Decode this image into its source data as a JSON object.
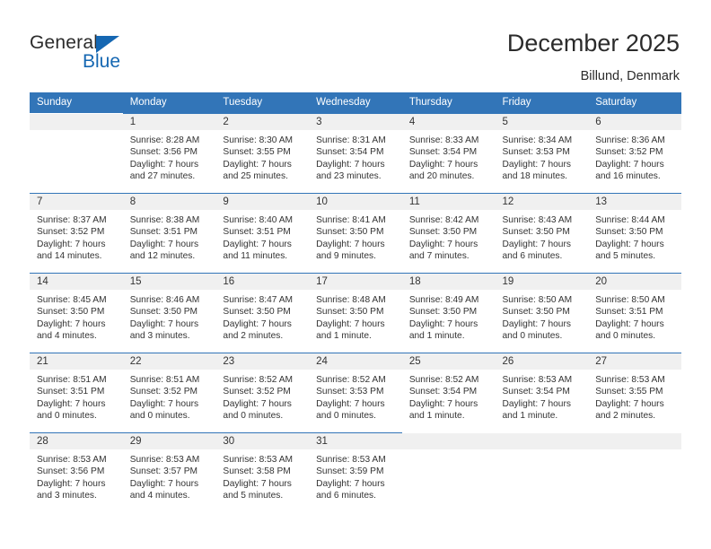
{
  "logo": {
    "word1": "General",
    "word2": "Blue",
    "triangle_color": "#1567b2",
    "text_color": "#2b2b2b"
  },
  "header": {
    "title": "December 2025",
    "subtitle": "Billund, Denmark"
  },
  "theme": {
    "header_blue": "#3275b8",
    "daynum_band": "#f0f0f0",
    "text": "#333333"
  },
  "weekday_headers": [
    "Sunday",
    "Monday",
    "Tuesday",
    "Wednesday",
    "Thursday",
    "Friday",
    "Saturday"
  ],
  "weeks": [
    [
      {
        "empty": true
      },
      {
        "day": "1",
        "sunrise": "Sunrise: 8:28 AM",
        "sunset": "Sunset: 3:56 PM",
        "daylight1": "Daylight: 7 hours",
        "daylight2": "and 27 minutes."
      },
      {
        "day": "2",
        "sunrise": "Sunrise: 8:30 AM",
        "sunset": "Sunset: 3:55 PM",
        "daylight1": "Daylight: 7 hours",
        "daylight2": "and 25 minutes."
      },
      {
        "day": "3",
        "sunrise": "Sunrise: 8:31 AM",
        "sunset": "Sunset: 3:54 PM",
        "daylight1": "Daylight: 7 hours",
        "daylight2": "and 23 minutes."
      },
      {
        "day": "4",
        "sunrise": "Sunrise: 8:33 AM",
        "sunset": "Sunset: 3:54 PM",
        "daylight1": "Daylight: 7 hours",
        "daylight2": "and 20 minutes."
      },
      {
        "day": "5",
        "sunrise": "Sunrise: 8:34 AM",
        "sunset": "Sunset: 3:53 PM",
        "daylight1": "Daylight: 7 hours",
        "daylight2": "and 18 minutes."
      },
      {
        "day": "6",
        "sunrise": "Sunrise: 8:36 AM",
        "sunset": "Sunset: 3:52 PM",
        "daylight1": "Daylight: 7 hours",
        "daylight2": "and 16 minutes."
      }
    ],
    [
      {
        "day": "7",
        "sunrise": "Sunrise: 8:37 AM",
        "sunset": "Sunset: 3:52 PM",
        "daylight1": "Daylight: 7 hours",
        "daylight2": "and 14 minutes."
      },
      {
        "day": "8",
        "sunrise": "Sunrise: 8:38 AM",
        "sunset": "Sunset: 3:51 PM",
        "daylight1": "Daylight: 7 hours",
        "daylight2": "and 12 minutes."
      },
      {
        "day": "9",
        "sunrise": "Sunrise: 8:40 AM",
        "sunset": "Sunset: 3:51 PM",
        "daylight1": "Daylight: 7 hours",
        "daylight2": "and 11 minutes."
      },
      {
        "day": "10",
        "sunrise": "Sunrise: 8:41 AM",
        "sunset": "Sunset: 3:50 PM",
        "daylight1": "Daylight: 7 hours",
        "daylight2": "and 9 minutes."
      },
      {
        "day": "11",
        "sunrise": "Sunrise: 8:42 AM",
        "sunset": "Sunset: 3:50 PM",
        "daylight1": "Daylight: 7 hours",
        "daylight2": "and 7 minutes."
      },
      {
        "day": "12",
        "sunrise": "Sunrise: 8:43 AM",
        "sunset": "Sunset: 3:50 PM",
        "daylight1": "Daylight: 7 hours",
        "daylight2": "and 6 minutes."
      },
      {
        "day": "13",
        "sunrise": "Sunrise: 8:44 AM",
        "sunset": "Sunset: 3:50 PM",
        "daylight1": "Daylight: 7 hours",
        "daylight2": "and 5 minutes."
      }
    ],
    [
      {
        "day": "14",
        "sunrise": "Sunrise: 8:45 AM",
        "sunset": "Sunset: 3:50 PM",
        "daylight1": "Daylight: 7 hours",
        "daylight2": "and 4 minutes."
      },
      {
        "day": "15",
        "sunrise": "Sunrise: 8:46 AM",
        "sunset": "Sunset: 3:50 PM",
        "daylight1": "Daylight: 7 hours",
        "daylight2": "and 3 minutes."
      },
      {
        "day": "16",
        "sunrise": "Sunrise: 8:47 AM",
        "sunset": "Sunset: 3:50 PM",
        "daylight1": "Daylight: 7 hours",
        "daylight2": "and 2 minutes."
      },
      {
        "day": "17",
        "sunrise": "Sunrise: 8:48 AM",
        "sunset": "Sunset: 3:50 PM",
        "daylight1": "Daylight: 7 hours",
        "daylight2": "and 1 minute."
      },
      {
        "day": "18",
        "sunrise": "Sunrise: 8:49 AM",
        "sunset": "Sunset: 3:50 PM",
        "daylight1": "Daylight: 7 hours",
        "daylight2": "and 1 minute."
      },
      {
        "day": "19",
        "sunrise": "Sunrise: 8:50 AM",
        "sunset": "Sunset: 3:50 PM",
        "daylight1": "Daylight: 7 hours",
        "daylight2": "and 0 minutes."
      },
      {
        "day": "20",
        "sunrise": "Sunrise: 8:50 AM",
        "sunset": "Sunset: 3:51 PM",
        "daylight1": "Daylight: 7 hours",
        "daylight2": "and 0 minutes."
      }
    ],
    [
      {
        "day": "21",
        "sunrise": "Sunrise: 8:51 AM",
        "sunset": "Sunset: 3:51 PM",
        "daylight1": "Daylight: 7 hours",
        "daylight2": "and 0 minutes."
      },
      {
        "day": "22",
        "sunrise": "Sunrise: 8:51 AM",
        "sunset": "Sunset: 3:52 PM",
        "daylight1": "Daylight: 7 hours",
        "daylight2": "and 0 minutes."
      },
      {
        "day": "23",
        "sunrise": "Sunrise: 8:52 AM",
        "sunset": "Sunset: 3:52 PM",
        "daylight1": "Daylight: 7 hours",
        "daylight2": "and 0 minutes."
      },
      {
        "day": "24",
        "sunrise": "Sunrise: 8:52 AM",
        "sunset": "Sunset: 3:53 PM",
        "daylight1": "Daylight: 7 hours",
        "daylight2": "and 0 minutes."
      },
      {
        "day": "25",
        "sunrise": "Sunrise: 8:52 AM",
        "sunset": "Sunset: 3:54 PM",
        "daylight1": "Daylight: 7 hours",
        "daylight2": "and 1 minute."
      },
      {
        "day": "26",
        "sunrise": "Sunrise: 8:53 AM",
        "sunset": "Sunset: 3:54 PM",
        "daylight1": "Daylight: 7 hours",
        "daylight2": "and 1 minute."
      },
      {
        "day": "27",
        "sunrise": "Sunrise: 8:53 AM",
        "sunset": "Sunset: 3:55 PM",
        "daylight1": "Daylight: 7 hours",
        "daylight2": "and 2 minutes."
      }
    ],
    [
      {
        "day": "28",
        "sunrise": "Sunrise: 8:53 AM",
        "sunset": "Sunset: 3:56 PM",
        "daylight1": "Daylight: 7 hours",
        "daylight2": "and 3 minutes."
      },
      {
        "day": "29",
        "sunrise": "Sunrise: 8:53 AM",
        "sunset": "Sunset: 3:57 PM",
        "daylight1": "Daylight: 7 hours",
        "daylight2": "and 4 minutes."
      },
      {
        "day": "30",
        "sunrise": "Sunrise: 8:53 AM",
        "sunset": "Sunset: 3:58 PM",
        "daylight1": "Daylight: 7 hours",
        "daylight2": "and 5 minutes."
      },
      {
        "day": "31",
        "sunrise": "Sunrise: 8:53 AM",
        "sunset": "Sunset: 3:59 PM",
        "daylight1": "Daylight: 7 hours",
        "daylight2": "and 6 minutes."
      },
      {
        "empty": true
      },
      {
        "empty": true
      },
      {
        "empty": true
      }
    ]
  ]
}
